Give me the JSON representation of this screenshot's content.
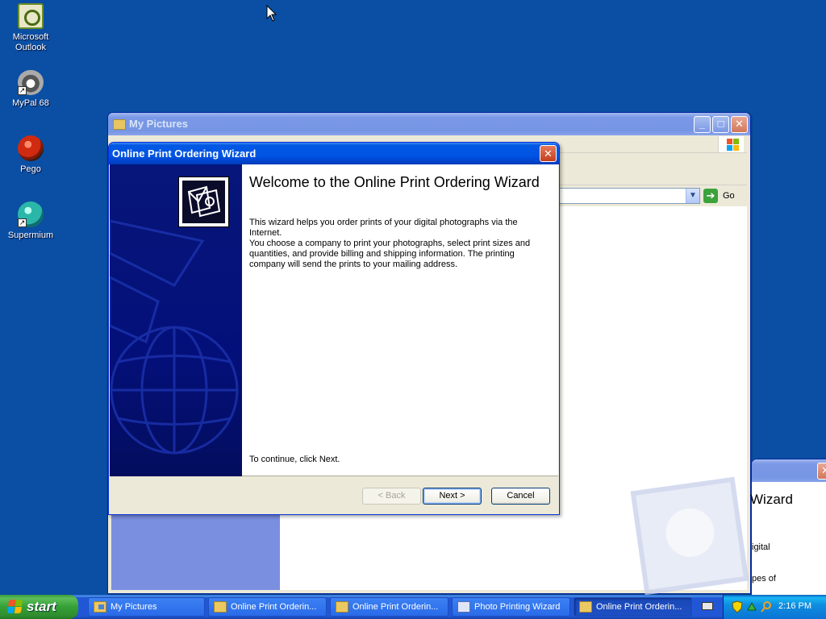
{
  "desktop": {
    "icons": [
      {
        "label": "Microsoft Outlook"
      },
      {
        "label": "MyPal 68"
      },
      {
        "label": "Pego"
      },
      {
        "label": "Supermium"
      }
    ]
  },
  "my_pictures_window": {
    "title": "My Pictures",
    "address_go_label": "Go",
    "buttons": {
      "minimize": "_",
      "maximize": "□",
      "close": "✕"
    }
  },
  "photo_printing_window": {
    "title_fragment": "",
    "heading_fragment": "Wizard",
    "text_fragment_1": "igital",
    "text_fragment_2": "pes of"
  },
  "wizard": {
    "title": "Online Print Ordering Wizard",
    "heading": "Welcome to the Online Print Ordering Wizard",
    "intro": "This wizard helps you order prints of your digital photographs via the Internet.",
    "description": "You choose a company to print your photographs, select print sizes and quantities, and provide billing and shipping information. The printing company will send the prints to your mailing address.",
    "continue_hint": "To continue, click Next.",
    "buttons": {
      "back": "< Back",
      "next": "Next >",
      "cancel": "Cancel",
      "close": "✕"
    }
  },
  "taskbar": {
    "start_label": "start",
    "items": [
      {
        "label": "My Pictures",
        "icon": "pictures-folder-icon",
        "active": false
      },
      {
        "label": "Online Print Orderin...",
        "icon": "folder-icon",
        "active": false
      },
      {
        "label": "Online Print Orderin...",
        "icon": "folder-icon",
        "active": false
      },
      {
        "label": "Photo Printing Wizard",
        "icon": "wizard-icon",
        "active": false
      },
      {
        "label": "Online Print Orderin...",
        "icon": "folder-icon",
        "active": true
      }
    ],
    "clock": "2:16 PM"
  },
  "colors": {
    "desktop": "#0a4fa3",
    "title_active": "#0054e3",
    "start_green": "#35a035"
  }
}
